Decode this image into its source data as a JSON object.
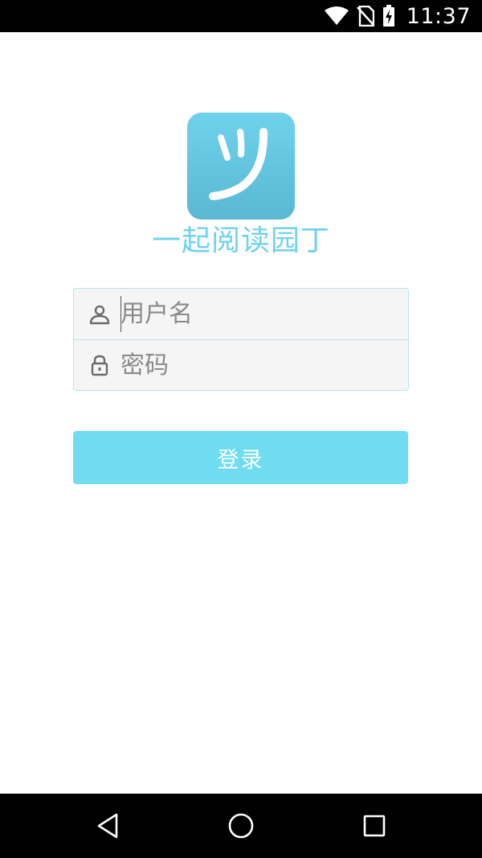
{
  "status_bar": {
    "time": "11:37",
    "icons": [
      "wifi-icon",
      "no-sim-icon",
      "battery-charging-icon"
    ]
  },
  "app": {
    "name": "一起阅读园丁",
    "logo_icon": "app-logo-icon",
    "brand_color": "#6fd3ee"
  },
  "form": {
    "username": {
      "placeholder": "用户名",
      "value": "",
      "icon": "user-icon"
    },
    "password": {
      "placeholder": "密码",
      "value": "",
      "icon": "lock-icon"
    }
  },
  "login_button": {
    "label": "登录",
    "color": "#6fdcf1"
  },
  "nav_bar": {
    "icons": [
      "back-icon",
      "home-icon",
      "recents-icon"
    ]
  }
}
